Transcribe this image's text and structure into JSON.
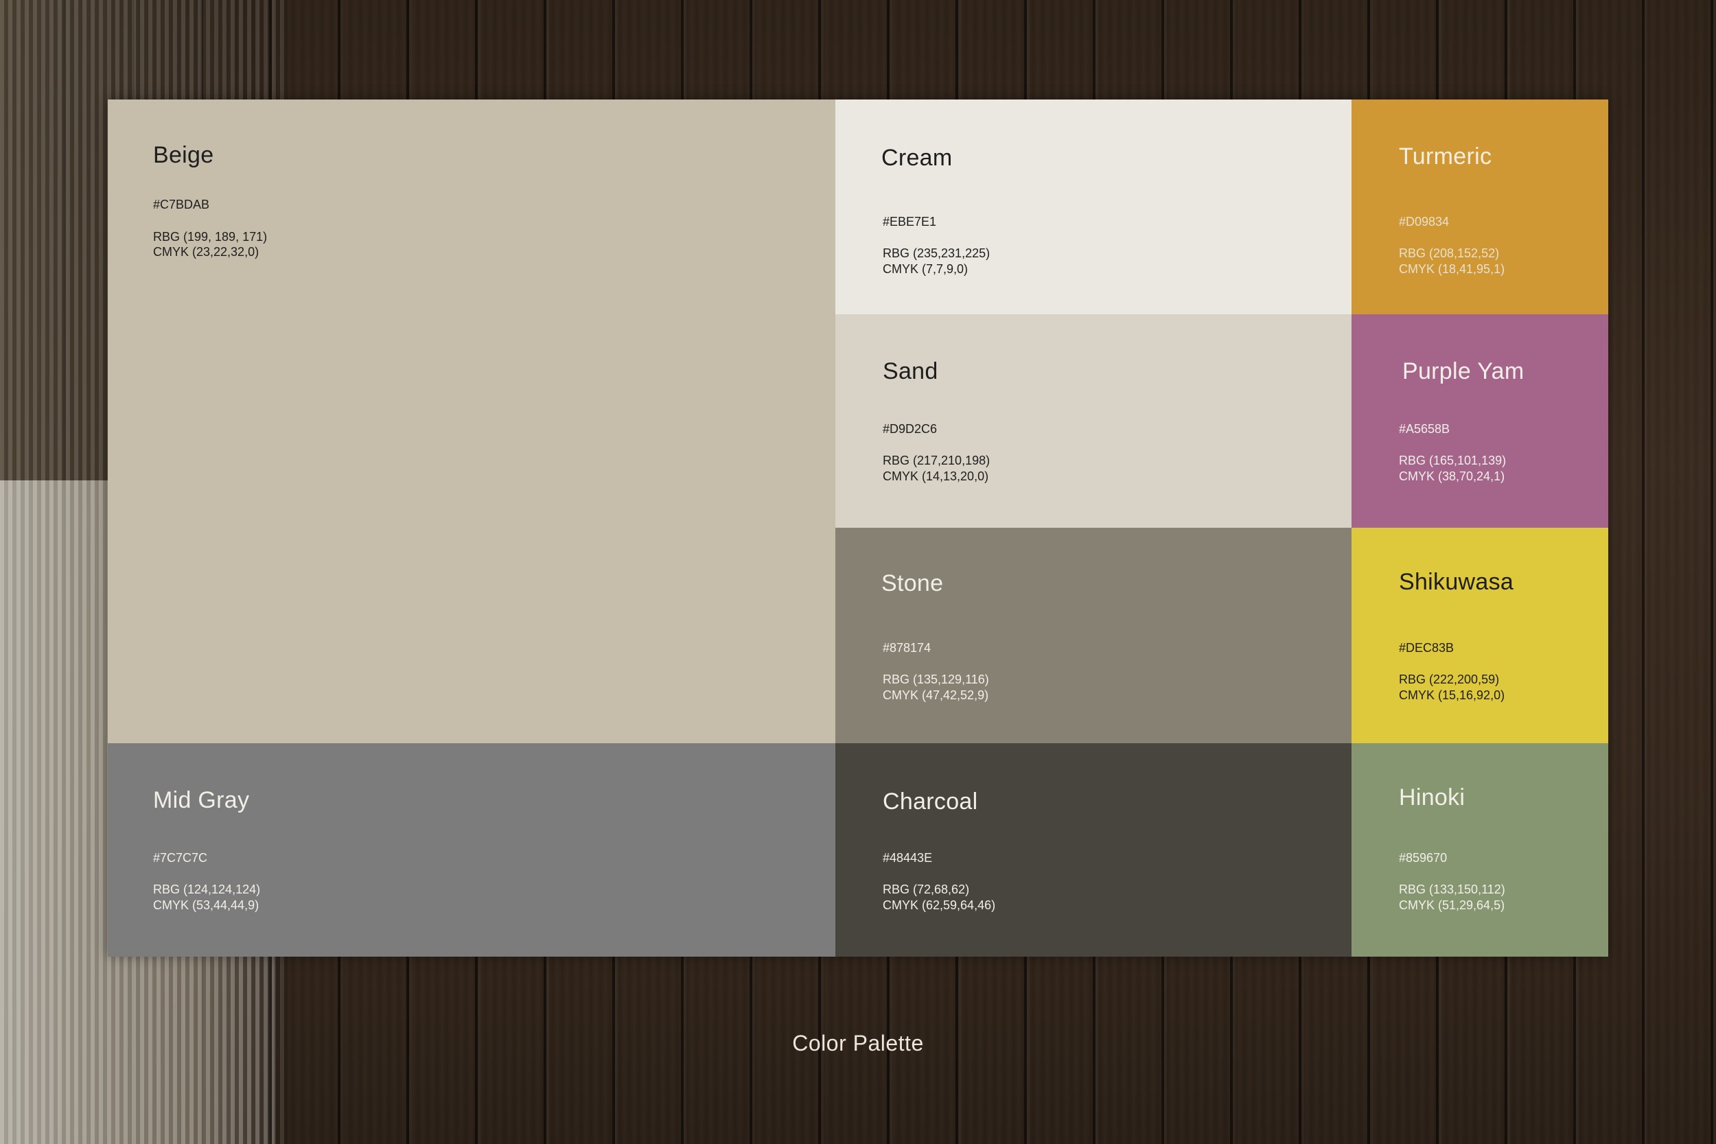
{
  "caption": "Color Palette",
  "swatches": [
    {
      "key": "beige",
      "name": "Beige",
      "hex": "#C7BDAB",
      "rgb": "RBG (199, 189, 171)",
      "cmyk": "CMYK (23,22,32,0)",
      "color": "#C7BDAB"
    },
    {
      "key": "cream",
      "name": "Cream",
      "hex": "#EBE7E1",
      "rgb": "RBG (235,231,225)",
      "cmyk": "CMYK (7,7,9,0)",
      "color": "#EBE7E1"
    },
    {
      "key": "turmeric",
      "name": "Turmeric",
      "hex": "#D09834",
      "rgb": "RBG (208,152,52)",
      "cmyk": "CMYK (18,41,95,1)",
      "color": "#D09834"
    },
    {
      "key": "sand",
      "name": "Sand",
      "hex": "#D9D2C6",
      "rgb": "RBG (217,210,198)",
      "cmyk": "CMYK (14,13,20,0)",
      "color": "#D9D2C6"
    },
    {
      "key": "purple_yam",
      "name": "Purple Yam",
      "hex": "#A5658B",
      "rgb": "RBG (165,101,139)",
      "cmyk": "CMYK (38,70,24,1)",
      "color": "#A5658B"
    },
    {
      "key": "stone",
      "name": "Stone",
      "hex": "#878174",
      "rgb": "RBG (135,129,116)",
      "cmyk": "CMYK (47,42,52,9)",
      "color": "#878174"
    },
    {
      "key": "shikuwasa",
      "name": "Shikuwasa",
      "hex": "#DEC83B",
      "rgb": "RBG (222,200,59)",
      "cmyk": "CMYK (15,16,92,0)",
      "color": "#DEC83B"
    },
    {
      "key": "mid_gray",
      "name": "Mid Gray",
      "hex": "#7C7C7C",
      "rgb": "RBG (124,124,124)",
      "cmyk": "CMYK (53,44,44,9)",
      "color": "#7C7C7C"
    },
    {
      "key": "charcoal",
      "name": "Charcoal",
      "hex": "#48443E",
      "rgb": "RBG (72,68,62)",
      "cmyk": "CMYK (62,59,64,46)",
      "color": "#48443E"
    },
    {
      "key": "hinoki",
      "name": "Hinoki",
      "hex": "#859670",
      "rgb": "RBG (133,150,112)",
      "cmyk": "CMYK (51,29,64,5)",
      "color": "#859670"
    }
  ]
}
